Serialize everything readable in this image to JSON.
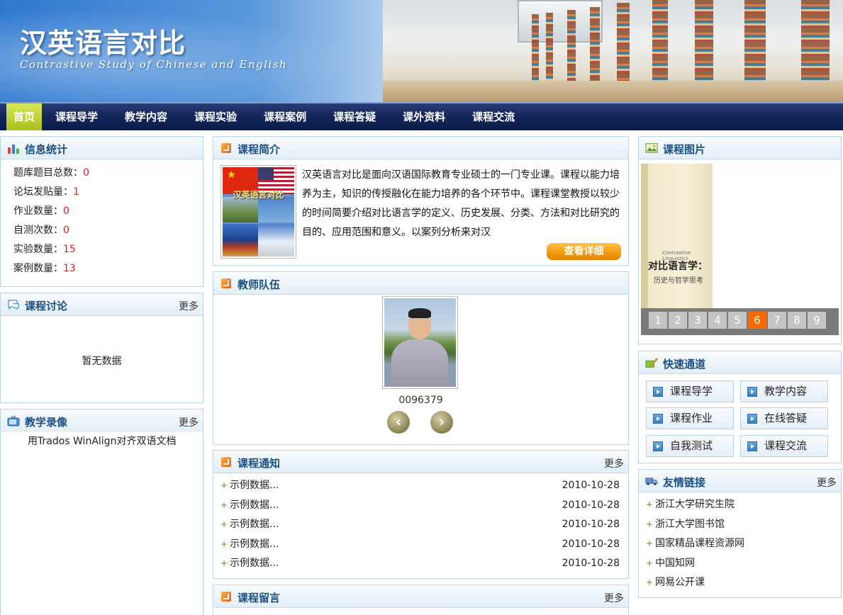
{
  "header": {
    "title": "汉英语言对比",
    "subtitle": "Contrastive Study of Chinese and English"
  },
  "nav": {
    "items": [
      {
        "label": "首页",
        "active": true
      },
      {
        "label": "课程导学"
      },
      {
        "label": "教学内容"
      },
      {
        "label": "课程实验"
      },
      {
        "label": "课程案例"
      },
      {
        "label": "课程答疑"
      },
      {
        "label": "课外资料"
      },
      {
        "label": "课程交流"
      }
    ]
  },
  "stats": {
    "title": "信息统计",
    "rows": [
      {
        "label": "题库题目总数：",
        "value": "0"
      },
      {
        "label": "论坛发贴量：",
        "value": "1"
      },
      {
        "label": "作业数量：",
        "value": "0"
      },
      {
        "label": "自测次数：",
        "value": "0"
      },
      {
        "label": "实验数量：",
        "value": "15"
      },
      {
        "label": "案例数量：",
        "value": "13"
      }
    ]
  },
  "discussion": {
    "title": "课程讨论",
    "more": "更多",
    "empty": "暂无数据"
  },
  "videos": {
    "title": "教学录像",
    "more": "更多",
    "items": [
      "用Trados WinAlign对齐双语文档"
    ]
  },
  "intro": {
    "title": "课程简介",
    "image_label": "汉英语言对比",
    "text": "汉英语言对比是面向汉语国际教育专业硕士的一门专业课。课程以能力培养为主，知识的传授融化在能力培养的各个环节中。课程课堂教授以较少的时间简要介绍对比语言学的定义、历史发展、分类、方法和对比研究的目的、应用范围和意义。以案列分析来对汉",
    "button": "查看详细"
  },
  "teachers": {
    "title": "教师队伍",
    "name": "0096379"
  },
  "notices": {
    "title": "课程通知",
    "more": "更多",
    "items": [
      {
        "text": "示例数据...",
        "date": "2010-10-28"
      },
      {
        "text": "示例数据...",
        "date": "2010-10-28"
      },
      {
        "text": "示例数据...",
        "date": "2010-10-28"
      },
      {
        "text": "示例数据...",
        "date": "2010-10-28"
      },
      {
        "text": "示例数据...",
        "date": "2010-10-28"
      }
    ]
  },
  "messages": {
    "title": "课程留言",
    "more": "更多"
  },
  "pictures": {
    "title": "课程图片",
    "book_en": "Contrastive Linguistics",
    "book_title": "对比语言学：",
    "book_sub": "历史与哲学思考",
    "pages": [
      "1",
      "2",
      "3",
      "4",
      "5",
      "6",
      "7",
      "8",
      "9"
    ],
    "active_page": "6"
  },
  "quick": {
    "title": "快速通道",
    "items": [
      "课程导学",
      "教学内容",
      "课程作业",
      "在线答疑",
      "自我测试",
      "课程交流"
    ]
  },
  "links": {
    "title": "友情链接",
    "more": "更多",
    "items": [
      "浙江大学研究生院",
      "浙江大学图书馆",
      "国家精品课程资源网",
      "中国知网",
      "网易公开课"
    ]
  },
  "colors": {
    "accent": "#1b4f82",
    "value_red": "#e02020",
    "nav_active": "#b8cf2a",
    "pager_active": "#ff6a00"
  }
}
